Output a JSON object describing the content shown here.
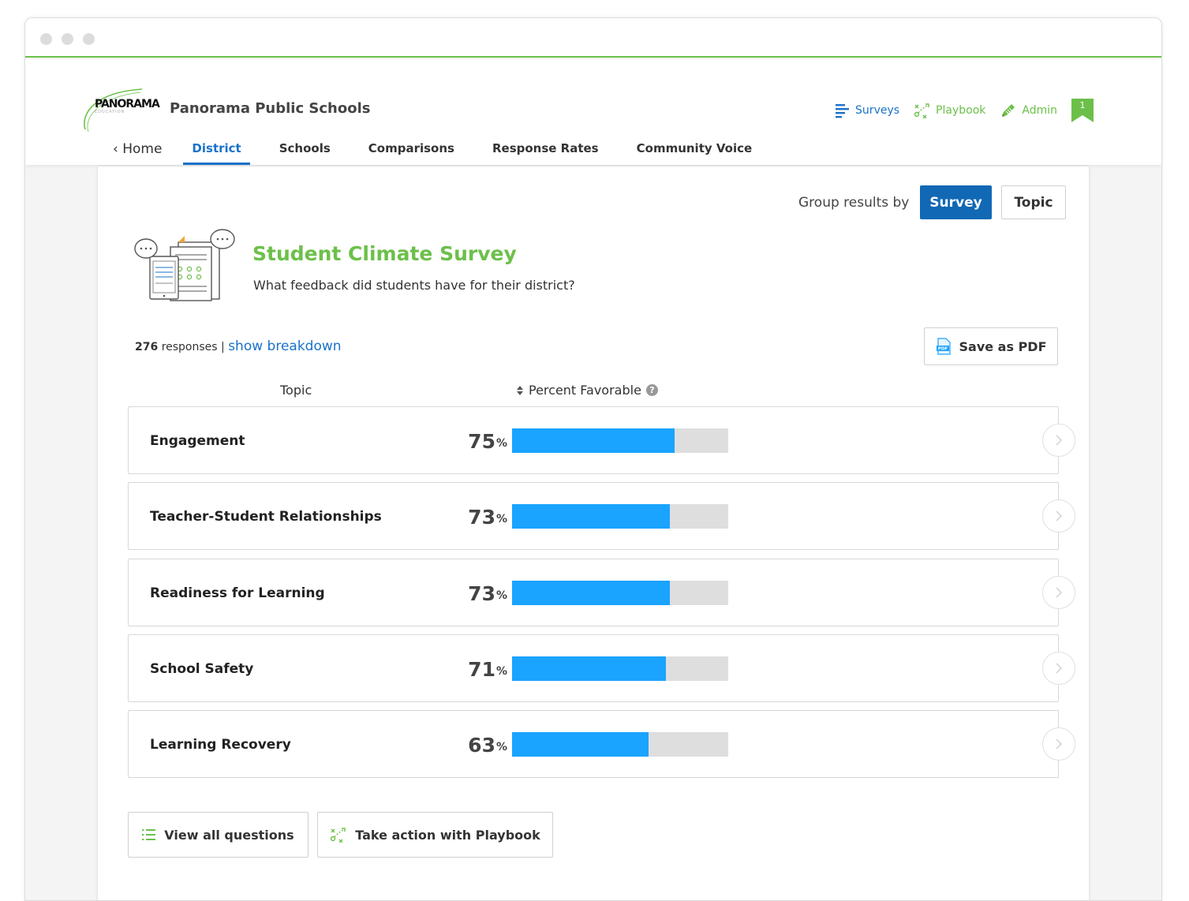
{
  "brand": {
    "logo_text": "PANORAMA",
    "logo_sub": "EDUCATION",
    "district_name": "Panorama Public Schools",
    "accent_green": "#6cc04a",
    "accent_blue": "#1a72c9"
  },
  "topnav": {
    "surveys": "Surveys",
    "playbook": "Playbook",
    "admin": "Admin",
    "bookmark_count": "1"
  },
  "tabs": {
    "home": "Home",
    "district": "District",
    "schools": "Schools",
    "comparisons": "Comparisons",
    "response_rates": "Response Rates",
    "community_voice": "Community Voice"
  },
  "group_by": {
    "label": "Group results by",
    "survey": "Survey",
    "topic": "Topic",
    "selected": "Survey"
  },
  "survey": {
    "title": "Student Climate Survey",
    "subtitle": "What feedback did students have for their district?",
    "responses_count": "276",
    "responses_label": "responses",
    "separator": "|",
    "breakdown_link": "show breakdown",
    "save_pdf": "Save as PDF"
  },
  "table": {
    "col_topic": "Topic",
    "col_percent": "Percent Favorable",
    "help_icon": "?",
    "rows": [
      {
        "label": "Engagement",
        "value": 75,
        "unit": "%"
      },
      {
        "label": "Teacher-Student Relationships",
        "value": 73,
        "unit": "%"
      },
      {
        "label": "Readiness for Learning",
        "value": 73,
        "unit": "%"
      },
      {
        "label": "School Safety",
        "value": 71,
        "unit": "%"
      },
      {
        "label": "Learning Recovery",
        "value": 63,
        "unit": "%"
      }
    ]
  },
  "actions": {
    "view_questions": "View all questions",
    "playbook_action": "Take action with Playbook"
  },
  "icons": {
    "surveys": "list-lines-icon",
    "playbook": "play-diagram-icon",
    "admin": "pencil-icon",
    "bookmark": "bookmark-icon",
    "back": "chevron-left-icon",
    "sort": "sort-icon",
    "row_arrow": "chevron-right-icon",
    "pdf": "pdf-file-icon"
  }
}
